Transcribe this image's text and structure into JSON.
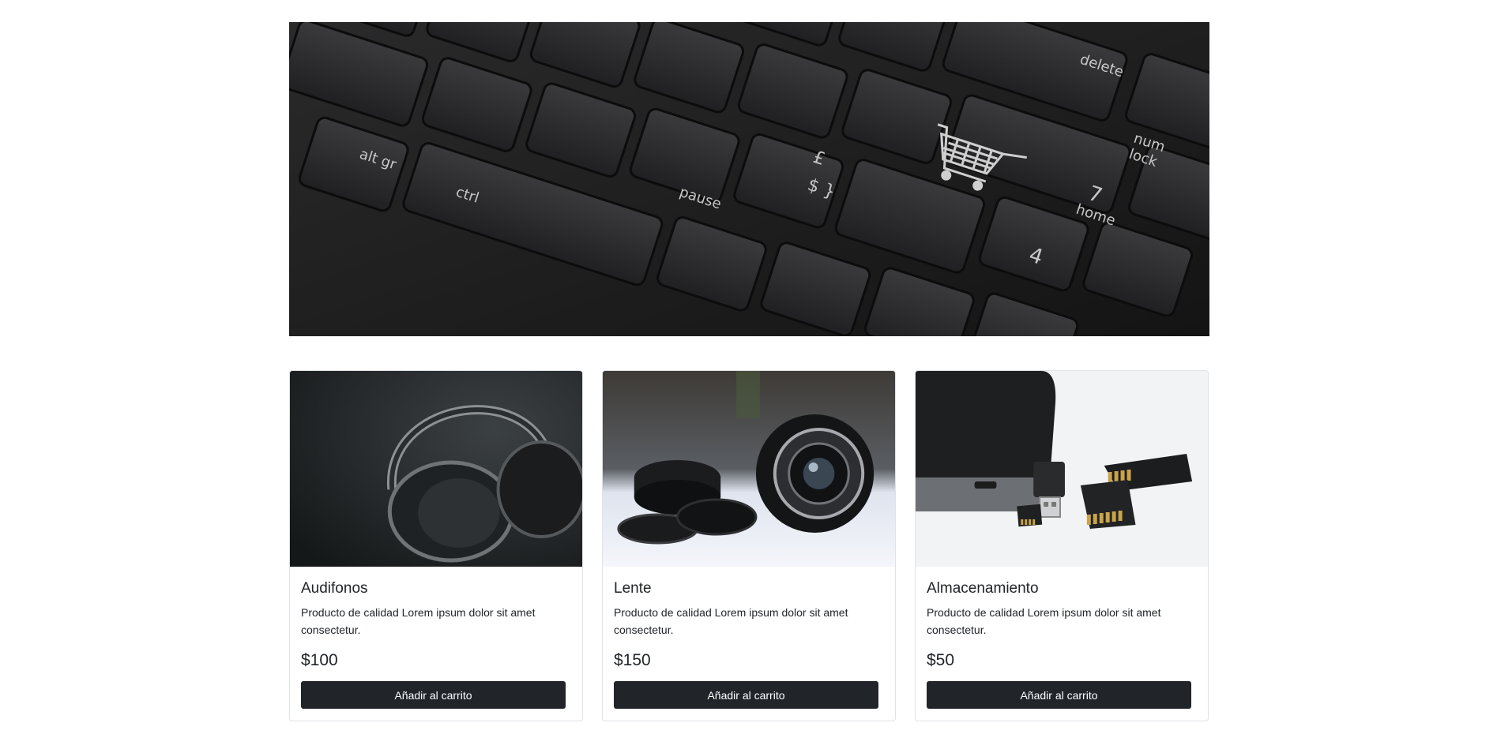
{
  "products": [
    {
      "name": "Audifonos",
      "description": "Producto de calidad Lorem ipsum dolor sit amet consectetur.",
      "price": "$100",
      "button_label": "Añadir al carrito"
    },
    {
      "name": "Lente",
      "description": "Producto de calidad Lorem ipsum dolor sit amet consectetur.",
      "price": "$150",
      "button_label": "Añadir al carrito"
    },
    {
      "name": "Almacenamiento",
      "description": "Producto de calidad Lorem ipsum dolor sit amet consectetur.",
      "price": "$50",
      "button_label": "Añadir al carrito"
    }
  ],
  "hero": {
    "key_labels": [
      "alt gr",
      "ctrl",
      "pause",
      "num lock",
      "7",
      "home",
      "4",
      "£",
      "$ }",
      "delete"
    ],
    "icon": "shopping-cart-icon"
  },
  "colors": {
    "button_bg": "#212529",
    "button_text": "#ffffff",
    "card_border": "#dfe2e6"
  }
}
